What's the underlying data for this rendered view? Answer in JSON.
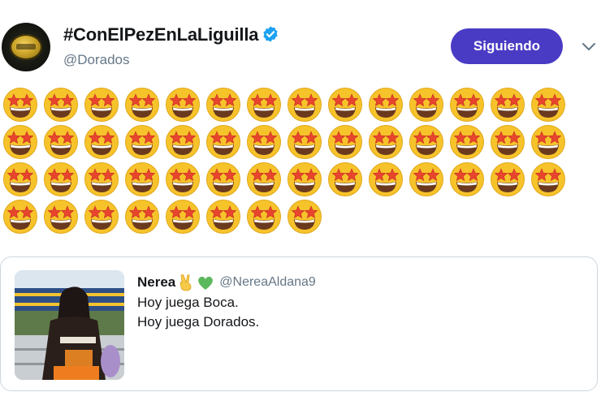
{
  "account": {
    "display_name": "#ConElPezEnLaLiguilla",
    "handle": "@Dorados",
    "verified_icon": "verified-badge-icon",
    "avatar_icon": "dorados-logo"
  },
  "follow_button": {
    "label": "Siguiendo",
    "color": "#4a3bc4"
  },
  "menu_icon": "chevron-down-icon",
  "tweet": {
    "emoji_name": "star-struck-emoji",
    "emoji_count": 50,
    "emojis_per_row": 14
  },
  "quoted_tweet": {
    "name": "Nerea",
    "name_emojis": [
      "victory-hand-emoji",
      "green-heart-emoji"
    ],
    "handle": "@NereaAldana9",
    "lines": [
      "Hoy juega Boca.",
      "Hoy juega Dorados."
    ],
    "photo_icon": "stadium-photo"
  }
}
